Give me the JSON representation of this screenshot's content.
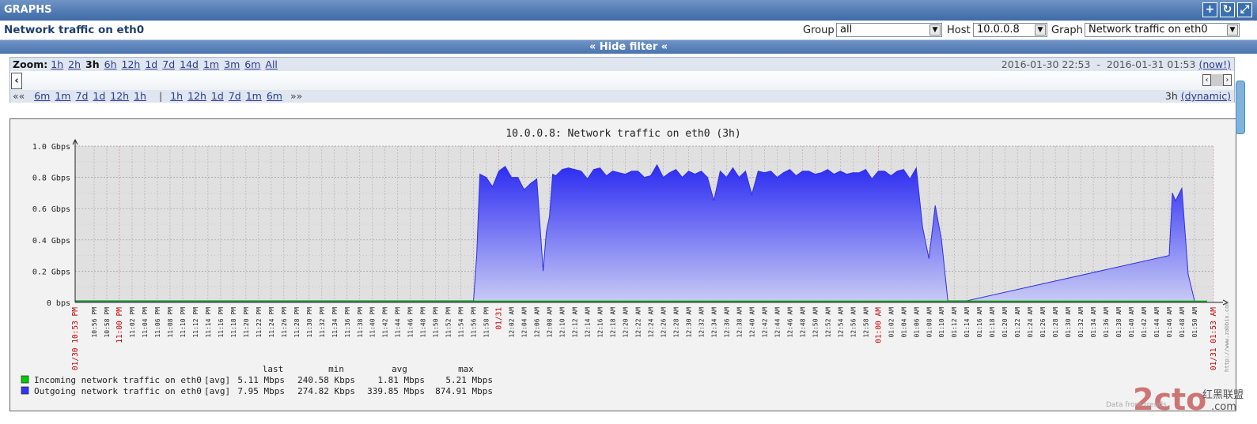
{
  "window_title": "GRAPHS",
  "title_icons": [
    "plus-icon",
    "refresh-icon",
    "fullscreen-icon"
  ],
  "page_title": "Network traffic on eth0",
  "filters": {
    "group_label": "Group",
    "group_value": "all",
    "host_label": "Host",
    "host_value": "10.0.0.8",
    "graph_label": "Graph",
    "graph_value": "Network traffic on eth0"
  },
  "hide_filter": "« Hide filter «",
  "zoom": {
    "label": "Zoom:",
    "options": [
      "1h",
      "2h",
      "3h",
      "6h",
      "12h",
      "1d",
      "7d",
      "14d",
      "1m",
      "3m",
      "6m",
      "All"
    ],
    "active": "3h",
    "range_from": "2016-01-30 22:53",
    "range_sep": "-",
    "range_to": "2016-01-31 01:53",
    "now": "(now!)"
  },
  "period_nav": {
    "back_label": "««",
    "back_options": [
      "6m",
      "1m",
      "7d",
      "1d",
      "12h",
      "1h"
    ],
    "separator": "|",
    "fwd_options": [
      "1h",
      "12h",
      "1d",
      "7d",
      "1m",
      "6m"
    ],
    "fwd_label": "»»",
    "period": "3h",
    "mode": "(dynamic)"
  },
  "chart_data": {
    "type": "area",
    "title": "10.0.0.8: Network traffic on eth0 (3h)",
    "ylabel": "",
    "ylim": [
      0,
      1.0
    ],
    "y_unit": "Gbps",
    "y_ticks": [
      "0 bps",
      "0.2 Gbps",
      "0.4 Gbps",
      "0.6 Gbps",
      "0.8 Gbps",
      "1.0 Gbps"
    ],
    "x_tick_labels": [
      "01/30 10:53 PM",
      "10:56 PM",
      "10:58 PM",
      "11:00 PM",
      "11:02 PM",
      "11:04 PM",
      "11:06 PM",
      "11:08 PM",
      "11:10 PM",
      "11:12 PM",
      "11:14 PM",
      "11:16 PM",
      "11:18 PM",
      "11:20 PM",
      "11:22 PM",
      "11:24 PM",
      "11:26 PM",
      "11:28 PM",
      "11:30 PM",
      "11:32 PM",
      "11:34 PM",
      "11:36 PM",
      "11:38 PM",
      "11:40 PM",
      "11:42 PM",
      "11:44 PM",
      "11:46 PM",
      "11:48 PM",
      "11:50 PM",
      "11:52 PM",
      "11:54 PM",
      "11:56 PM",
      "11:58 PM",
      "01/31",
      "12:02 AM",
      "12:04 AM",
      "12:06 AM",
      "12:08 AM",
      "12:10 AM",
      "12:12 AM",
      "12:14 AM",
      "12:16 AM",
      "12:18 AM",
      "12:20 AM",
      "12:22 AM",
      "12:24 AM",
      "12:26 AM",
      "12:28 AM",
      "12:30 AM",
      "12:32 AM",
      "12:34 AM",
      "12:36 AM",
      "12:38 AM",
      "12:40 AM",
      "12:42 AM",
      "12:44 AM",
      "12:46 AM",
      "12:48 AM",
      "12:50 AM",
      "12:52 AM",
      "12:54 AM",
      "12:56 AM",
      "12:58 AM",
      "01:00 AM",
      "01:02 AM",
      "01:04 AM",
      "01:06 AM",
      "01:08 AM",
      "01:10 AM",
      "01:12 AM",
      "01:14 AM",
      "01:16 AM",
      "01:18 AM",
      "01:20 AM",
      "01:22 AM",
      "01:24 AM",
      "01:26 AM",
      "01:28 AM",
      "01:30 AM",
      "01:32 AM",
      "01:34 AM",
      "01:36 AM",
      "01:38 AM",
      "01:40 AM",
      "01:42 AM",
      "01:44 AM",
      "01:46 AM",
      "01:48 AM",
      "01:50 AM",
      "01/31 01:53 AM"
    ],
    "x_tick_red": [
      "01/30 10:53 PM",
      "11:00 PM",
      "01/31",
      "01:00 AM",
      "01/31 01:53 AM"
    ],
    "x_minutes": [
      0,
      63,
      63.5,
      64,
      65,
      66,
      67,
      68,
      69,
      70,
      71,
      72,
      73,
      74,
      74.5,
      75,
      75.5,
      76,
      77,
      78,
      79,
      80,
      81,
      82,
      83,
      84,
      85,
      86,
      87,
      88,
      89,
      90,
      91,
      92,
      93,
      94,
      95,
      96,
      97,
      98,
      99,
      100,
      101,
      102,
      103,
      104,
      105,
      106,
      107,
      108,
      109,
      110,
      111,
      112,
      113,
      114,
      115,
      116,
      117,
      118,
      119,
      120,
      121,
      122,
      123,
      124,
      125,
      126,
      127,
      128,
      129,
      130,
      131,
      132,
      133,
      134,
      134.5,
      135,
      136,
      137,
      138,
      139,
      140,
      141,
      173,
      173.5,
      174,
      175,
      176,
      177,
      180
    ],
    "series": [
      {
        "name": "Outgoing network traffic on eth0",
        "color": "#3f3ff0",
        "values": [
          0.01,
          0.01,
          0.3,
          0.82,
          0.8,
          0.74,
          0.84,
          0.87,
          0.8,
          0.8,
          0.72,
          0.76,
          0.79,
          0.2,
          0.45,
          0.55,
          0.82,
          0.81,
          0.85,
          0.86,
          0.85,
          0.84,
          0.79,
          0.85,
          0.86,
          0.81,
          0.84,
          0.83,
          0.82,
          0.84,
          0.84,
          0.8,
          0.81,
          0.88,
          0.8,
          0.83,
          0.85,
          0.8,
          0.84,
          0.82,
          0.84,
          0.8,
          0.65,
          0.84,
          0.8,
          0.86,
          0.8,
          0.84,
          0.69,
          0.84,
          0.83,
          0.84,
          0.8,
          0.83,
          0.85,
          0.81,
          0.84,
          0.84,
          0.82,
          0.83,
          0.85,
          0.82,
          0.84,
          0.82,
          0.83,
          0.83,
          0.85,
          0.79,
          0.84,
          0.84,
          0.81,
          0.84,
          0.85,
          0.79,
          0.86,
          0.48,
          0.38,
          0.28,
          0.62,
          0.4,
          0.01,
          0.01,
          0.01,
          0.01,
          0.3,
          0.7,
          0.65,
          0.73,
          0.18,
          0.01
        ]
      },
      {
        "name": "Incoming network traffic on eth0",
        "color": "#00aa00",
        "values": "near zero"
      }
    ],
    "legend": {
      "headers": [
        "last",
        "min",
        "avg",
        "max"
      ],
      "rows": [
        {
          "name": "Incoming network traffic on eth0",
          "color": "#00cc00",
          "func": "[avg]",
          "last": "5.11 Mbps",
          "min": "240.58 Kbps",
          "avg": "1.81 Mbps",
          "max": "5.21 Mbps"
        },
        {
          "name": "Outgoing network traffic on eth0",
          "color": "#3333ff",
          "func": "[avg]",
          "last": "7.95 Mbps",
          "min": "274.82 Kbps",
          "avg": "339.85 Mbps",
          "max": "874.91 Mbps"
        }
      ]
    },
    "grid": true,
    "side_text": "http://www.zabbix.com",
    "footer_text": "Data from trends"
  },
  "watermark": {
    "logo": "2cto",
    "cn1": "红黑联盟",
    "cn2": ".com"
  }
}
